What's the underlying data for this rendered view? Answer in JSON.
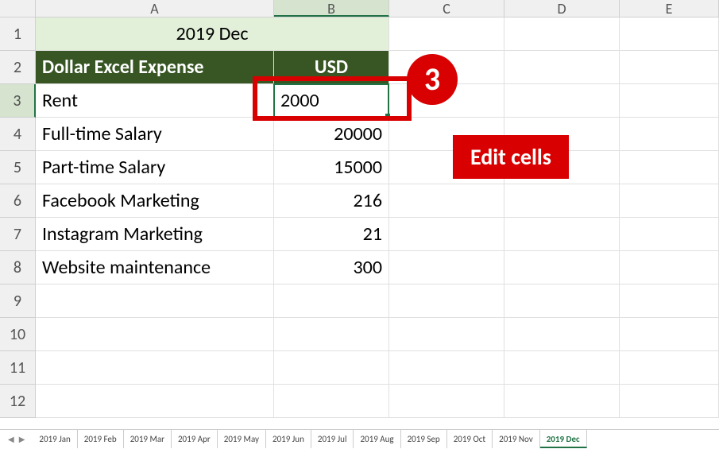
{
  "columns": [
    "A",
    "B",
    "C",
    "D",
    "E"
  ],
  "row_numbers": [
    1,
    2,
    3,
    4,
    5,
    6,
    7,
    8,
    9,
    10,
    11,
    12
  ],
  "active_col": "B",
  "active_row": 3,
  "title_cell": "2019 Dec",
  "header": {
    "a": "Dollar Excel Expense",
    "b": "USD"
  },
  "data_rows": [
    {
      "label": "Rent",
      "value": "2000"
    },
    {
      "label": "Full-time Salary",
      "value": "20000"
    },
    {
      "label": "Part-time Salary",
      "value": "15000"
    },
    {
      "label": "Facebook Marketing",
      "value": "216"
    },
    {
      "label": "Instagram Marketing",
      "value": "21"
    },
    {
      "label": "Website maintenance",
      "value": "300"
    }
  ],
  "annotations": {
    "badge": "3",
    "callout": "Edit cells"
  },
  "tabs": [
    "2019 Jan",
    "2019 Feb",
    "2019 Mar",
    "2019 Apr",
    "2019 May",
    "2019 Jun",
    "2019 Jul",
    "2019 Aug",
    "2019 Sep",
    "2019 Oct",
    "2019 Nov",
    "2019 Dec"
  ],
  "active_tab": "2019 Dec",
  "chart_data": {
    "type": "table",
    "title": "2019 Dec — Dollar Excel Expense (USD)",
    "columns": [
      "Expense",
      "USD"
    ],
    "rows": [
      [
        "Rent",
        2000
      ],
      [
        "Full-time Salary",
        20000
      ],
      [
        "Part-time Salary",
        15000
      ],
      [
        "Facebook Marketing",
        216
      ],
      [
        "Instagram Marketing",
        21
      ],
      [
        "Website maintenance",
        300
      ]
    ]
  }
}
